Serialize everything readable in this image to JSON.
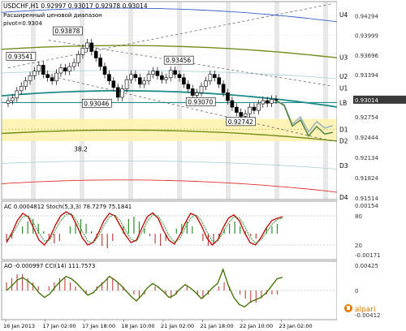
{
  "header": {
    "symbol_line": "USDCHF,H1  0.92997 0.93017 0.92978 0.93014",
    "subtitle_1": "Расширенный ценовой диапазон",
    "subtitle_2": "pivot=0.9304"
  },
  "brand": {
    "name": "alpari",
    "color": "#e07a00"
  },
  "colors": {
    "price_up": "#a00000",
    "price_down": "#a00000",
    "trend_teal": "#1f8a8a",
    "envelope_olive": "#6f8f1a",
    "upper_blue": "#3a5fcd",
    "lower_red": "#e03030",
    "zone_yellow": "#fff2b0",
    "forecast_gray": "#9fb4c0",
    "stoch_main": "#c00000",
    "stoch_signal": "#2f8f2f",
    "cci": "#3f6f00",
    "ao_hist": "#c04040",
    "current_price_box": "#3a3a3a"
  },
  "chart_data": [
    {
      "type": "line",
      "panel": "price",
      "title": "USDCHF,H1",
      "ylim": [
        0.9149,
        0.9451
      ],
      "y_ticks": [
        "0.94294",
        "0.93999",
        "0.93696",
        "0.93394",
        "0.93014",
        "0.92754",
        "0.92444",
        "0.92134",
        "0.91824",
        "0.91514"
      ],
      "current_price": "0.93014",
      "x_ticks": [
        "16 Jan 2013",
        "17 Jan 02:00",
        "17 Jan 18:00",
        "18 Jan 10:00",
        "21 Jan 02:00",
        "21 Jan 18:00",
        "22 Jan 10:00",
        "23 Jan 02:00"
      ],
      "close_series": [
        0.93,
        0.9304,
        0.9315,
        0.9322,
        0.933,
        0.9338,
        0.9345,
        0.9354,
        0.934,
        0.9335,
        0.933,
        0.9342,
        0.935,
        0.9345,
        0.9352,
        0.9358,
        0.937,
        0.938,
        0.9388,
        0.9375,
        0.9365,
        0.9352,
        0.934,
        0.933,
        0.932,
        0.9305,
        0.9318,
        0.9332,
        0.934,
        0.9335,
        0.9325,
        0.933,
        0.934,
        0.9345,
        0.9338,
        0.9332,
        0.9335,
        0.9346,
        0.934,
        0.9335,
        0.9325,
        0.9318,
        0.9308,
        0.9312,
        0.9322,
        0.933,
        0.934,
        0.9335,
        0.9325,
        0.9312,
        0.93,
        0.929,
        0.9282,
        0.9276,
        0.928,
        0.929,
        0.9285,
        0.9295,
        0.93,
        0.9296,
        0.9302,
        0.9301
      ],
      "price_labels": [
        {
          "text": "0.93878",
          "value": 0.93878
        },
        {
          "text": "0.93541",
          "value": 0.93541
        },
        {
          "text": "0.93456",
          "value": 0.93456
        },
        {
          "text": "0.93070",
          "value": 0.9307
        },
        {
          "text": "0.93046",
          "value": 0.93046
        },
        {
          "text": "0.92742",
          "value": 0.92742
        },
        {
          "text": "38.2",
          "value": 0.9272
        }
      ],
      "levels": [
        {
          "name": "U4",
          "value": 0.9431
        },
        {
          "name": "U3",
          "value": 0.9366
        },
        {
          "name": "U2",
          "value": 0.9337
        },
        {
          "name": "U1",
          "value": 0.9319
        },
        {
          "name": "LB",
          "value": 0.9297
        },
        {
          "name": "D1",
          "value": 0.9256
        },
        {
          "name": "D2",
          "value": 0.9239
        },
        {
          "name": "D3",
          "value": 0.9201
        },
        {
          "name": "D4",
          "value": 0.9153
        }
      ],
      "forecast": [
        0.93,
        0.9294,
        0.9264,
        0.9275,
        0.9252,
        0.9268,
        0.9258,
        0.9262
      ]
    },
    {
      "type": "line",
      "panel": "oscillator",
      "title": "AC 0.0004812  Stoch(5,3,3) 78.7279 75.1841",
      "y_ticks": [
        "0.00154",
        "80",
        "20",
        "-0.00171"
      ],
      "series": [
        {
          "name": "Stoch(5,3,3) main",
          "values": [
            25,
            45,
            70,
            85,
            78,
            55,
            30,
            20,
            35,
            60,
            80,
            88,
            82,
            60,
            35,
            20,
            25,
            45,
            70,
            85,
            80,
            60,
            40,
            25,
            30,
            55,
            78,
            86,
            75,
            50,
            30,
            22,
            40,
            65,
            85,
            80,
            60,
            35,
            20,
            30,
            55,
            75,
            82,
            70,
            45,
            25,
            20,
            35,
            55,
            70,
            75,
            78
          ]
        },
        {
          "name": "Stoch(5,3,3) signal",
          "values": [
            30,
            40,
            60,
            78,
            80,
            65,
            45,
            28,
            30,
            50,
            70,
            82,
            84,
            70,
            48,
            28,
            24,
            38,
            60,
            78,
            82,
            70,
            50,
            32,
            28,
            45,
            68,
            82,
            80,
            62,
            40,
            26,
            32,
            55,
            75,
            82,
            70,
            48,
            28,
            28,
            45,
            65,
            78,
            76,
            58,
            36,
            24,
            30,
            46,
            62,
            72,
            75
          ]
        }
      ],
      "ac_histogram": [
        -3,
        -2,
        0,
        3,
        5,
        6,
        4,
        1,
        -2,
        -4,
        -3,
        0,
        3,
        5,
        6,
        4,
        1,
        -2,
        -5,
        -6,
        -3,
        0,
        3,
        6,
        7,
        5,
        2,
        -1,
        -4,
        -5,
        -3,
        0,
        2,
        4,
        5,
        3,
        0,
        -3,
        -5,
        -4,
        -1,
        2,
        4,
        5,
        3,
        1,
        -1,
        -2,
        0,
        2,
        3,
        4
      ]
    },
    {
      "type": "line",
      "panel": "oscillator",
      "title": "AO -0.000997  CCI(14) 111.7573",
      "y_ticks": [
        "0.00425",
        "0",
        "-0.00412"
      ],
      "series": [
        {
          "name": "CCI(14)",
          "values": [
            0,
            40,
            90,
            110,
            80,
            40,
            -20,
            -60,
            -30,
            30,
            80,
            120,
            100,
            60,
            10,
            -40,
            -20,
            30,
            70,
            120,
            90,
            50,
            0,
            -50,
            -90,
            -40,
            20,
            60,
            30,
            -10,
            -60,
            -40,
            10,
            50,
            20,
            -20,
            -70,
            -30,
            20,
            60,
            180,
            40,
            -60,
            -120,
            -140,
            -100,
            -80,
            -60,
            -20,
            40,
            100,
            112
          ]
        },
        {
          "name": "AO",
          "values": [
            2,
            3,
            4,
            4,
            3,
            2,
            1,
            0,
            1,
            2,
            3,
            3,
            2,
            1,
            0,
            -1,
            0,
            1,
            2,
            3,
            3,
            2,
            1,
            0,
            -1,
            -2,
            -1,
            0,
            1,
            0,
            -1,
            -2,
            -1,
            0,
            1,
            0,
            -1,
            -2,
            -1,
            0,
            1,
            2,
            1,
            0,
            -1,
            -2,
            -3,
            -3,
            -2,
            -1,
            -1,
            -1
          ]
        }
      ]
    }
  ]
}
